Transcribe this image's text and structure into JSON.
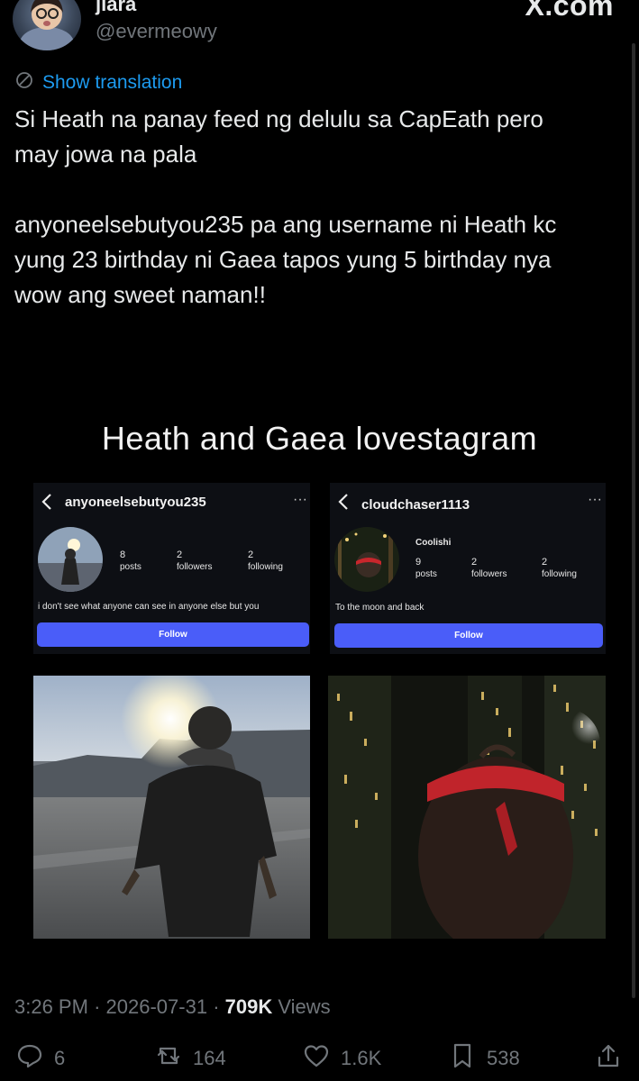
{
  "header": {
    "display_name": "jiara",
    "handle": "@evermeowy",
    "brand": "X.com"
  },
  "translation": {
    "label": "Show translation"
  },
  "tweet": {
    "text": "Si Heath na panay feed ng delulu sa CapEath pero\nmay jowa na pala\n\nanyoneelsebutyou235 pa ang username ni Heath kc\nyung 23 birthday ni Gaea tapos yung 5 birthday nya\nwow ang sweet naman!!"
  },
  "collage": {
    "title": "Heath and Gaea lovestagram",
    "left_profile": {
      "username": "anyoneelsebutyou235",
      "more": "···",
      "posts_count": "8",
      "posts_label": "posts",
      "followers_count": "2",
      "followers_label": "followers",
      "following_count": "2",
      "following_label": "following",
      "bio": "i don't see what anyone can see in anyone else but you",
      "follow_label": "Follow"
    },
    "right_profile": {
      "username": "cloudchaser1113",
      "more": "···",
      "display_name": "Coolishi",
      "posts_count": "9",
      "posts_label": "posts",
      "followers_count": "2",
      "followers_label": "followers",
      "following_count": "2",
      "following_label": "following",
      "bio": "To the moon and back",
      "follow_label": "Follow"
    }
  },
  "meta": {
    "time": "3:26 PM",
    "separator": "·",
    "date": "2026-07-31",
    "views_count": "709K",
    "views_label": "Views"
  },
  "actions": {
    "replies": "6",
    "reposts": "164",
    "likes": "1.6K",
    "bookmarks": "538"
  },
  "colors": {
    "background": "#000000",
    "text": "#e7e9ea",
    "muted": "#71767b",
    "link": "#1d9bf0",
    "follow_button": "#4a5df9"
  }
}
